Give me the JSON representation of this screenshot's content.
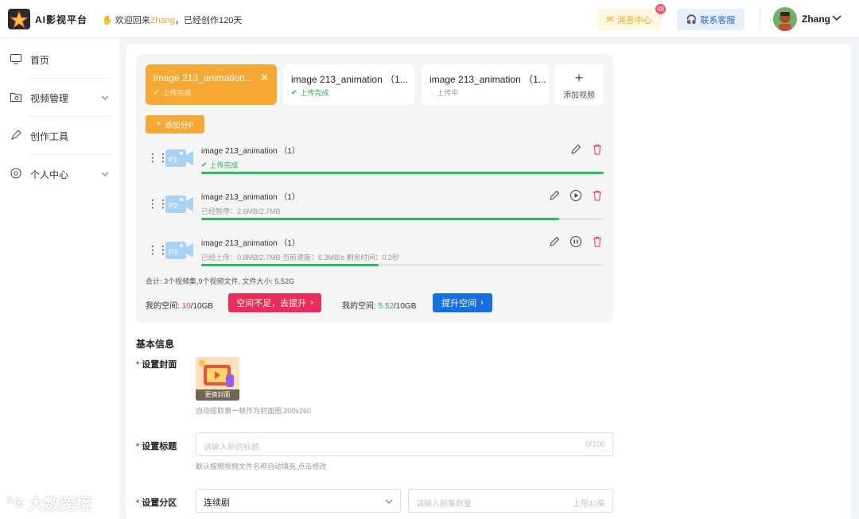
{
  "header": {
    "app_title": "AI影视平台",
    "welcome_prefix": "欢迎回来",
    "user_highlight": "Zhang",
    "welcome_suffix": "，已经创作120天",
    "messages_label": "消息中心",
    "messages_badge": "48",
    "support_label": "联系客服",
    "user_name": "Zhang"
  },
  "sidebar": {
    "items": [
      {
        "label": "首页",
        "icon": "monitor-icon"
      },
      {
        "label": "视频管理",
        "icon": "folder-video-icon"
      },
      {
        "label": "创作工具",
        "icon": "brush-icon"
      },
      {
        "label": "个人中心",
        "icon": "settings-icon"
      }
    ]
  },
  "tabs": [
    {
      "title": "image 213_animation...",
      "status": "上传完成",
      "active": true
    },
    {
      "title": "image 213_animation （1...",
      "status": "上传完成"
    },
    {
      "title": "image 213_animation （1...",
      "status": "上传中"
    }
  ],
  "add_video_label": "添加视频",
  "add_part_label": "添加分P",
  "parts": [
    {
      "tag": "P1",
      "name": "image 213_animation （1）",
      "status": "上传完成",
      "progress": 1.0
    },
    {
      "tag": "P2",
      "name": "image 213_animation （1）",
      "status": "已经暂停：2.6MB/2.7MB",
      "progress": 0.89
    },
    {
      "tag": "P3",
      "name": "image 213_animation （1）",
      "status": "已经上传：0.8MB/2.7MB 当前速度：6.3MB/s 剩余时间：0.2秒",
      "progress": 0.44
    }
  ],
  "summary": "合计: 3个视频集,9个视频文件, 文件大小: 5.52G",
  "space1": {
    "label": "我的空间:",
    "used": "10",
    "total": "/10GB",
    "button": "空间不足，去提升"
  },
  "space2": {
    "label": "我的空间:",
    "used": "5.52",
    "total": "/10GB",
    "button": "提升空间"
  },
  "basic_info": {
    "title": "基本信息",
    "cover_label": "设置封面",
    "cover_button": "更换封面",
    "cover_hint": "自动提取第一帧作为封面图,200x260",
    "title_label": "设置标题",
    "title_placeholder": "请输入新的标题",
    "title_counter": "0/100",
    "title_hint": "默认按照视频文件名称自动填充,点击修改",
    "category_label": "设置分区",
    "category_value": "连续剧",
    "episode_placeholder": "请输入剧集数量",
    "episode_limit": "上限40集"
  },
  "watermark": "大数跨境",
  "colors": {
    "accent": "#f5a833",
    "success": "#2bbd60",
    "danger": "#ec2d59",
    "primary": "#1470e0"
  }
}
